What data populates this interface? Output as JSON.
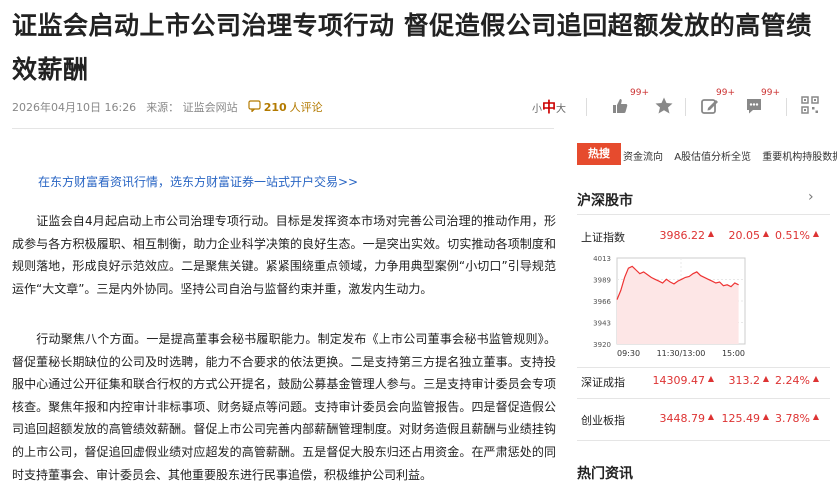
{
  "article": {
    "title": "证监会启动上市公司治理专项行动 督促造假公司追回超额发放的高管绩效薪酬",
    "date": "2026年04月10日 16:26",
    "source": "来源：  证监会网站",
    "comments_count": "210",
    "comments_suffix": "人评论",
    "ad_link": "在东方财富看资讯行情，选东方财富证券一站式开户交易>>",
    "paragraphs": [
      "证监会自4月起启动上市公司治理专项行动。目标是发挥资本市场对完善公司治理的推动作用，形成参与各方积极履职、相互制衡，助力企业科学决策的良好生态。一是突出实效。切实推动各项制度和规则落地，形成良好示范效应。二是聚焦关键。紧紧围绕重点领域，力争用典型案例“小切口”引导规范运作“大文章”。三是内外协同。坚持公司自治与监督约束并重，激发内生动力。",
      "行动聚焦八个方面。一是提高董事会秘书履职能力。制定发布《上市公司董事会秘书监管规则》。督促董秘长期缺位的公司及时选聘，能力不合要求的依法更换。二是支持第三方提名独立董事。支持投服中心通过公开征集和联合行权的方式公开提名，鼓励公募基金管理人参与。三是支持审计委员会专项核查。聚焦年报和内控审计非标事项、财务疑点等问题。支持审计委员会向监管报告。四是督促造假公司追回超额发放的高管绩效薪酬。督促上市公司完善内部薪酬管理制度。对财务造假且薪酬与业绩挂钩的上市公司，督促追回虚假业绩对应超发的高管薪酬。五是督促大股东归还占用资金。在严肃惩处的同时支持董事会、审计委员会、其他重要股东进行民事追偿，积极维护公司利益。"
    ]
  },
  "toolbar": {
    "font_small": "小",
    "font_mid": "中",
    "font_large": "大",
    "like_badge": "99+",
    "share_badge": "99+",
    "comment_badge": "99+"
  },
  "sidebar": {
    "hot_tag": "热搜",
    "hot_links": [
      "资金流向",
      "A股估值分析全览",
      "重要机构持股数据"
    ],
    "market_title": "沪深股市",
    "more": "›",
    "indices": [
      {
        "name": "上证指数",
        "value": "3986.22",
        "change": "20.05",
        "pct": "0.51%"
      },
      {
        "name": "深证成指",
        "value": "14309.47",
        "change": "313.2",
        "pct": "2.24%"
      },
      {
        "name": "创业板指",
        "value": "3448.79",
        "change": "125.49",
        "pct": "3.78%"
      }
    ],
    "hot_info_title": "热门资讯"
  },
  "chart_data": {
    "type": "line",
    "y_ticks": [
      "4013",
      "3989",
      "3966",
      "3943",
      "3920"
    ],
    "x_ticks": [
      "09:30",
      "11:30/13:00",
      "15:00"
    ],
    "ylim": [
      3920,
      4013
    ],
    "watermark": "东方财富",
    "series": [
      {
        "values": [
          3968,
          3978,
          3992,
          4002,
          4004,
          4000,
          3996,
          3998,
          3995,
          3992,
          3990,
          3988,
          3986,
          3990,
          3987,
          3985,
          3988,
          3990,
          3992,
          3993,
          3996,
          3998,
          3994,
          3992,
          3990,
          3988,
          3986,
          3987,
          3983,
          3984,
          3982,
          3986,
          3984
        ]
      }
    ],
    "colors": {
      "line": "#e33",
      "fill": "#fde6e6",
      "grid": "#e8e8e8"
    }
  }
}
